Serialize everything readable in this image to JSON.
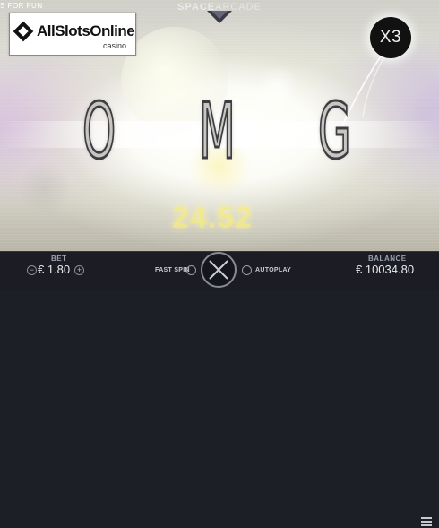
{
  "game": {
    "title_bold": "SPACE",
    "title_thin": "ARCADE",
    "corner_text": "S FOR FUN",
    "logo_brand": "AllSlotsOnline",
    "logo_tld": ".casino"
  },
  "reels": {
    "letters": [
      "O",
      "M",
      "G"
    ],
    "multiplier": "X3",
    "timer": "24.52"
  },
  "controls": {
    "bet_label": "BET",
    "bet_value": "€ 1.80",
    "fast_spin_label": "FAST SPIN",
    "autoplay_label": "AUTOPLAY",
    "balance_label": "BALANCE",
    "balance_value": "€ 10034.80"
  },
  "colors": {
    "bar": "#1b1c24",
    "timer": "#f5eb78"
  }
}
